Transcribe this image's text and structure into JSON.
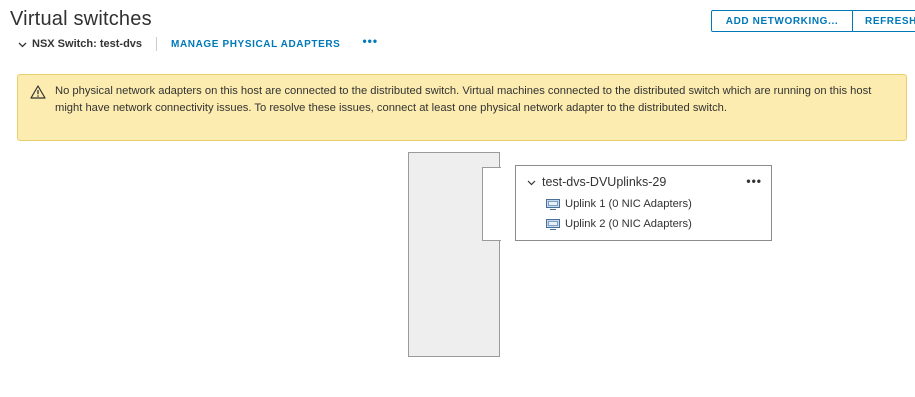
{
  "header": {
    "title": "Virtual switches",
    "add_networking_label": "ADD NETWORKING...",
    "refresh_label": "REFRESH"
  },
  "switch": {
    "name": "NSX Switch: test-dvs",
    "manage_adapters_label": "MANAGE PHYSICAL ADAPTERS",
    "more_label": "•••"
  },
  "alert": {
    "icon": "warning-triangle-icon",
    "message": "No physical network adapters on this host are connected to the distributed switch. Virtual machines connected to the distributed switch which are running on this host might have network connectivity issues. To resolve these issues, connect at least one physical network adapter to the distributed switch.",
    "background_color": "#fcecaf",
    "border_color": "#e9cf6c"
  },
  "uplink_group": {
    "title": "test-dvs-DVUplinks-29",
    "more_label": "•••",
    "uplinks": [
      {
        "label": "Uplink 1 (0 NIC Adapters)",
        "icon": "nic-adapter-icon"
      },
      {
        "label": "Uplink 2 (0 NIC Adapters)",
        "icon": "nic-adapter-icon"
      }
    ]
  },
  "colors": {
    "accent": "#0079b8",
    "text": "#333333"
  }
}
